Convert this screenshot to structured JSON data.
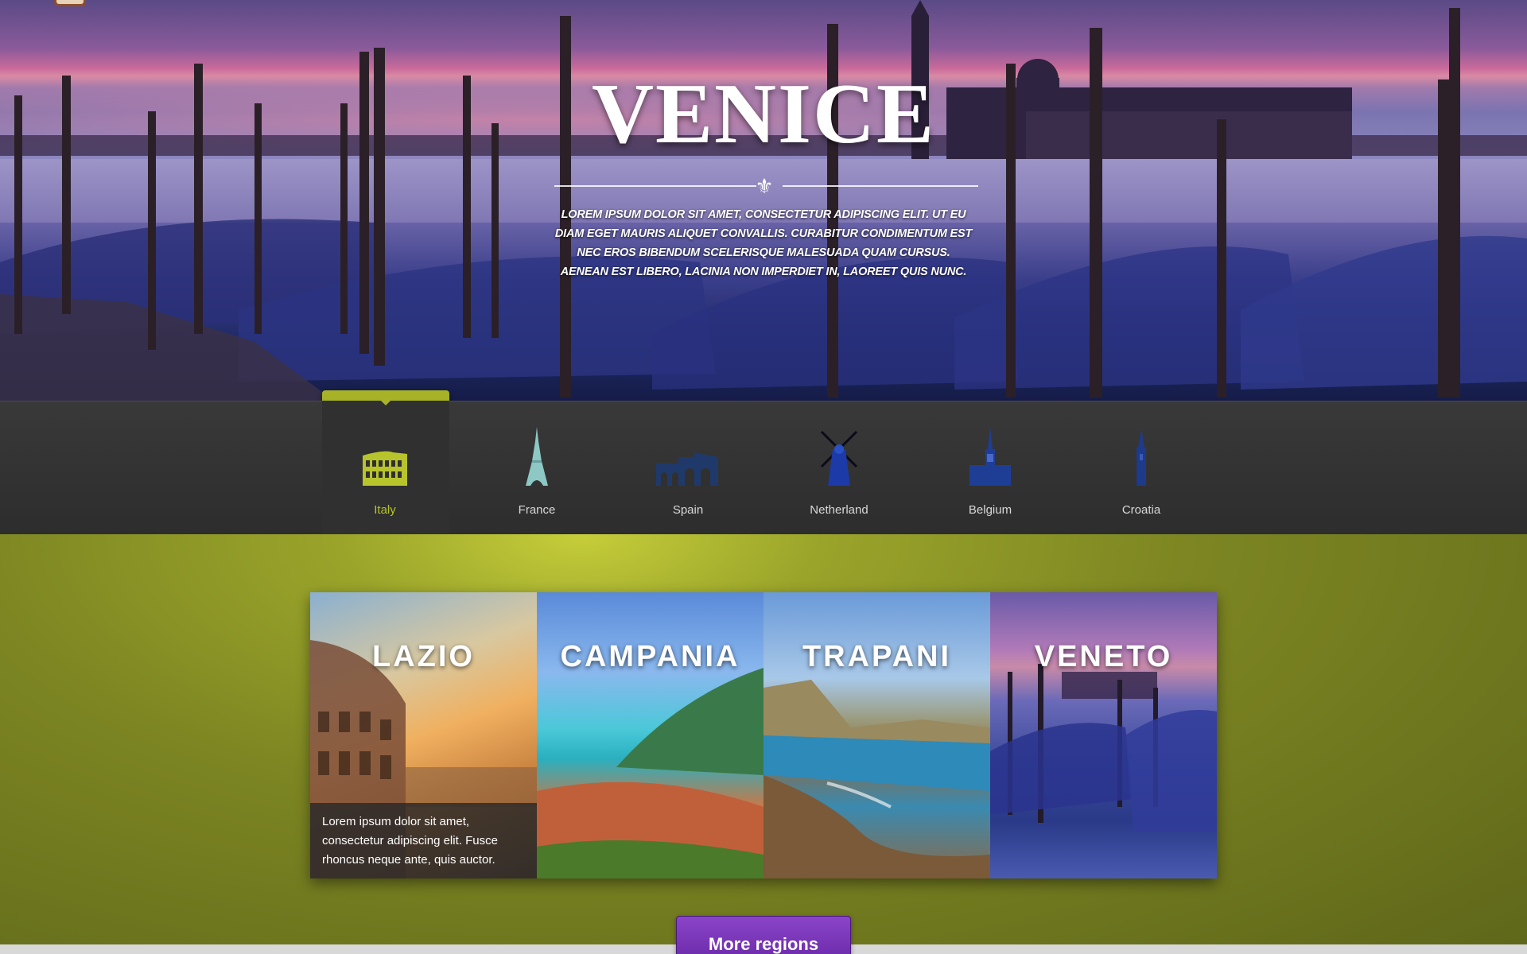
{
  "hero": {
    "title": "VENICE",
    "text": "Lorem ipsum dolor sit amet, consectetur adipiscing elit. Ut eu diam eget mauris aliquet convallis. Curabitur condimentum est nec eros bibendum scelerisque malesuada quam cursus. Aenean est libero, lacinia non imperdiet in, laoreet quis nunc.",
    "divider_icon": "fleur-de-lis-icon"
  },
  "countries": [
    {
      "label": "Italy",
      "icon": "colosseum-icon",
      "active": true
    },
    {
      "label": "France",
      "icon": "eiffel-tower-icon",
      "active": false
    },
    {
      "label": "Spain",
      "icon": "aqueduct-icon",
      "active": false
    },
    {
      "label": "Netherland",
      "icon": "windmill-icon",
      "active": false
    },
    {
      "label": "Belgium",
      "icon": "cathedral-icon",
      "active": false
    },
    {
      "label": "Croatia",
      "icon": "tower-icon",
      "active": false
    }
  ],
  "regions": [
    {
      "title": "LAZIO",
      "desc": "Lorem ipsum dolor sit amet, consectetur adipiscing elit. Fusce rhoncus neque ante, quis auctor."
    },
    {
      "title": "CAMPANIA"
    },
    {
      "title": "TRAPANI"
    },
    {
      "title": "VENETO"
    }
  ],
  "more_button": "More regions",
  "colors": {
    "accent_green": "#a8b426",
    "button_purple": "#7a38b8",
    "nav_bg": "#333333"
  }
}
